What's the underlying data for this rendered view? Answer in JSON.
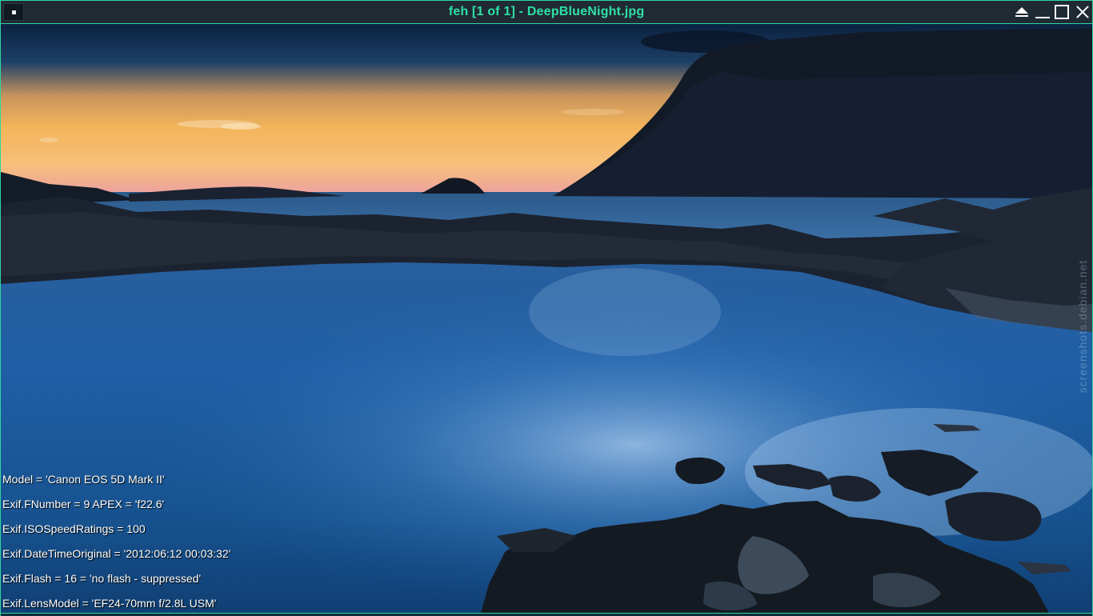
{
  "window": {
    "title": "feh [1 of 1] - DeepBlueNight.jpg",
    "accent_color": "#2fd6a0"
  },
  "titlebar_buttons": [
    {
      "name": "always-on-top",
      "icon": "always-on-top-icon"
    },
    {
      "name": "minimize",
      "icon": "minimize-icon"
    },
    {
      "name": "maximize",
      "icon": "maximize-icon"
    },
    {
      "name": "close",
      "icon": "close-icon"
    }
  ],
  "image": {
    "description_icon": "landscape-photo",
    "sky_top": "#0e2a4e",
    "sunset_glow": "#f4b25a",
    "water": "#1f5fa4"
  },
  "exif": {
    "model": "Model = 'Canon EOS 5D Mark II'",
    "fnumber": "Exif.FNumber = 9 APEX = 'f22.6'",
    "iso": "Exif.ISOSpeedRatings = 100",
    "datetime": "Exif.DateTimeOriginal = '2012:06:12 00:03:32'",
    "flash": "Exif.Flash = 16 = 'no flash - suppressed'",
    "lens": "Exif.LensModel = 'EF24-70mm f/2.8L USM'"
  },
  "watermark": "screenshots.debian.net"
}
